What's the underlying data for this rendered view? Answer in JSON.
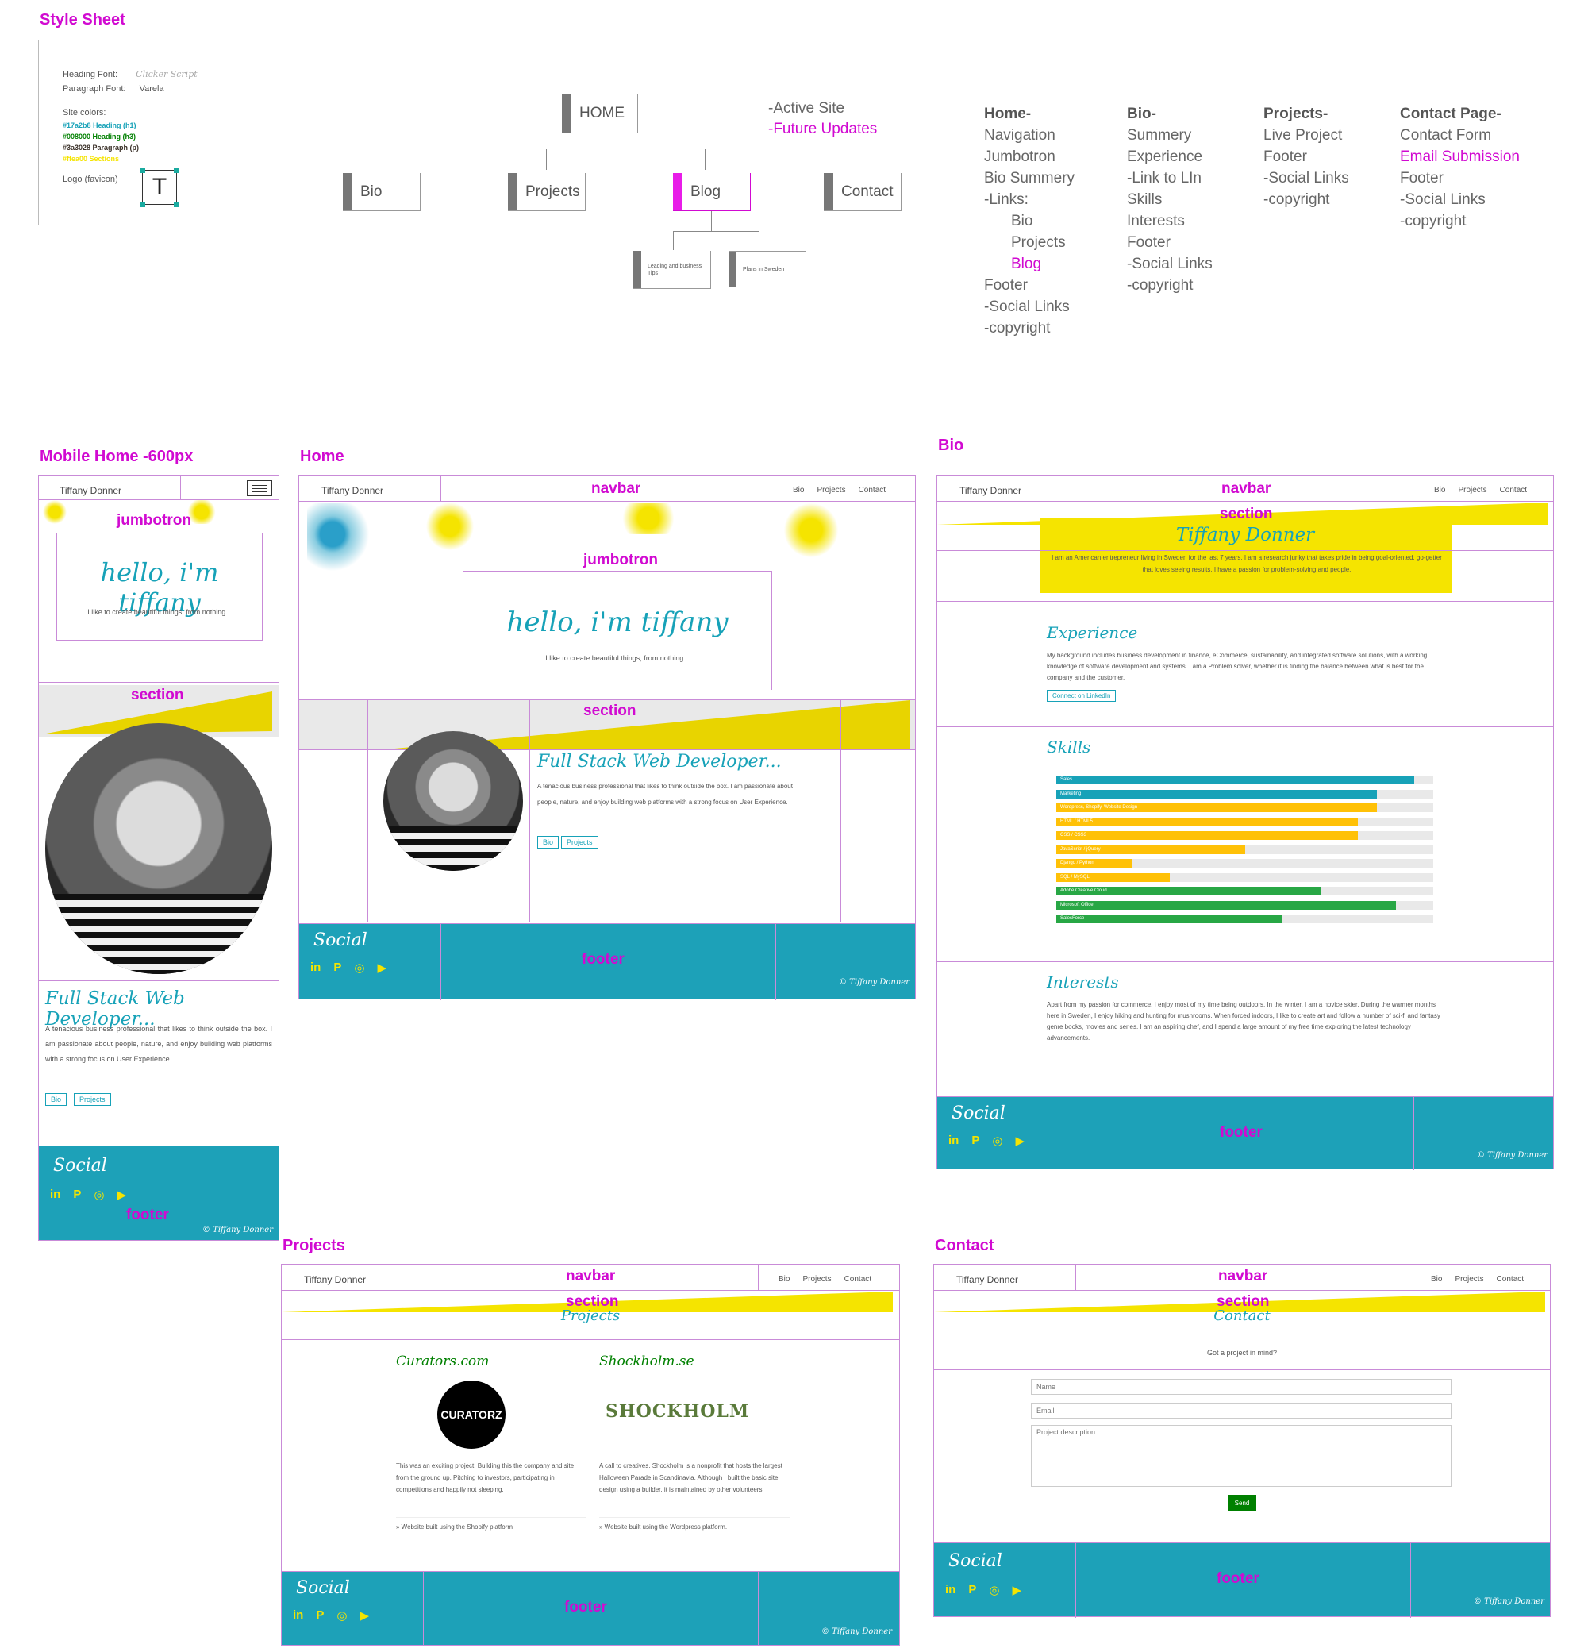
{
  "style_sheet": {
    "title": "Style Sheet",
    "heading_font_label": "Heading Font:",
    "heading_font_value": "Clicker Script",
    "paragraph_font_label": "Paragraph Font:",
    "paragraph_font_value": "Varela",
    "site_colors_label": "Site colors:",
    "colors": [
      {
        "text": "#17a2b8 Heading (h1)",
        "hex": "#17a2b8"
      },
      {
        "text": "#008000 Heading (h3)",
        "hex": "#008000"
      },
      {
        "text": "#3a3028 Paragraph (p)",
        "hex": "#3a3028"
      },
      {
        "text": "#ffea00 Sections",
        "hex": "#ffea00"
      }
    ],
    "logo_label": "Logo (favicon)",
    "logo_letter": "T"
  },
  "sitemap": {
    "home": "HOME",
    "bio": "Bio",
    "projects": "Projects",
    "blog": "Blog",
    "contact": "Contact",
    "blog_sub1": "Leading and business Tips",
    "blog_sub2": "Plans in Sweden",
    "legend_active": "-Active Site",
    "legend_future": "-Future Updates"
  },
  "outline": {
    "home": [
      "Home-",
      "Navigation",
      "Jumbotron",
      "Bio Summery",
      "-Links:",
      "Bio",
      "Projects",
      "Blog",
      "Footer",
      "-Social Links",
      "-copyright"
    ],
    "bio": [
      "Bio-",
      "Summery",
      "Experience",
      "-Link to LIn",
      "Skills",
      "Interests",
      "Footer",
      "-Social Links",
      "-copyright"
    ],
    "projects": [
      "Projects-",
      "Live Project",
      "Footer",
      "-Social Links",
      "-copyright"
    ],
    "contact": [
      "Contact Page-",
      "Contact Form",
      "Email Submission",
      "Footer",
      "-Social Links",
      "-copyright"
    ]
  },
  "labels": {
    "mobile": "Mobile Home -600px",
    "home": "Home",
    "bio": "Bio",
    "projects": "Projects",
    "contact": "Contact",
    "navbar": "navbar",
    "jumbotron": "jumbotron",
    "section": "section",
    "footer": "footer"
  },
  "site": {
    "brand": "Tiffany Donner",
    "nav": [
      "Bio",
      "Projects",
      "Contact"
    ],
    "hello": "hello, i'm tiffany",
    "tagline": "I like to create beautiful things, from nothing...",
    "fullstack": "Full Stack Web Developer...",
    "about": "A tenacious business professional that likes to think outside the box. I am passionate about people, nature, and enjoy building web platforms with a strong focus on User Experience.",
    "btn_bio": "Bio",
    "btn_projects": "Projects",
    "social": "Social",
    "social_icons": [
      "in",
      "P",
      "◎",
      "▶"
    ],
    "copyright": "© Tiffany Donner"
  },
  "bio": {
    "name": "Tiffany Donner",
    "summary": "I am an American entrepreneur living in Sweden for the last 7 years. I am a research junky that takes pride in being goal-oriented, go-getter that loves seeing results. I have a passion for problem-solving and people.",
    "experience_title": "Experience",
    "experience_text": "My background includes business development in finance, eCommerce, sustainability, and integrated software solutions, with a working knowledge of software development and systems. I am a Problem solver, whether it is finding the balance between what is best for the company and the customer.",
    "linkedin_button": "Connect on LinkedIn",
    "skills_title": "Skills",
    "skills": [
      {
        "name": "Sales",
        "level": 0.95,
        "color": "#17a2b8"
      },
      {
        "name": "Marketing",
        "level": 0.85,
        "color": "#17a2b8"
      },
      {
        "name": "Wordpress, Shopify, Website Design",
        "level": 0.85,
        "color": "#ffc107"
      },
      {
        "name": "HTML / HTML5",
        "level": 0.8,
        "color": "#ffc107"
      },
      {
        "name": "CSS / CSS3",
        "level": 0.8,
        "color": "#ffc107"
      },
      {
        "name": "JavaScript / jQuery",
        "level": 0.5,
        "color": "#ffc107"
      },
      {
        "name": "Django / Python",
        "level": 0.2,
        "color": "#ffc107"
      },
      {
        "name": "SQL / MySQL",
        "level": 0.3,
        "color": "#ffc107"
      },
      {
        "name": "Adobe Creative Cloud",
        "level": 0.7,
        "color": "#28a745"
      },
      {
        "name": "Microsoft Office",
        "level": 0.9,
        "color": "#28a745"
      },
      {
        "name": "SalesForce",
        "level": 0.6,
        "color": "#28a745"
      }
    ],
    "interests_title": "Interests",
    "interests_text": "Apart from my passion for commerce, I enjoy most of my time being outdoors. In the winter, I am a novice skier. During the warmer months here in Sweden, I enjoy hiking and hunting for mushrooms. When forced indoors, I like to create art and follow a number of sci-fi and fantasy genre books, movies and series. I am an aspiring chef, and I spend a large amount of my free time exploring the latest technology advancements."
  },
  "projects": {
    "title": "Projects",
    "p1_title": "Curators.com",
    "p1_logo": "CURATORZ",
    "p1_text": "This was an exciting project! Building this the company and site from the ground up. Pitching to investors, participating in competitions and happily not sleeping.",
    "p1_note": "» Website built using the Shopify platform",
    "p2_title": "Shockholm.se",
    "p2_logo": "SHOCKHOLM",
    "p2_text": "A call to creatives. Shockholm is a nonprofit that hosts the largest Halloween Parade in Scandinavia. Although I built the basic site design using a builder, it is maintained by other volunteers.",
    "p2_note": "» Website built using the Wordpress platform."
  },
  "contact": {
    "title": "Contact",
    "prompt": "Got a project in mind?",
    "name_placeholder": "Name",
    "email_placeholder": "Email",
    "desc_placeholder": "Project description",
    "send": "Send"
  },
  "colors": {
    "teal": "#17a2b8",
    "yellow": "#ffea00",
    "magenta": "#d10ad1",
    "green": "#008000"
  }
}
